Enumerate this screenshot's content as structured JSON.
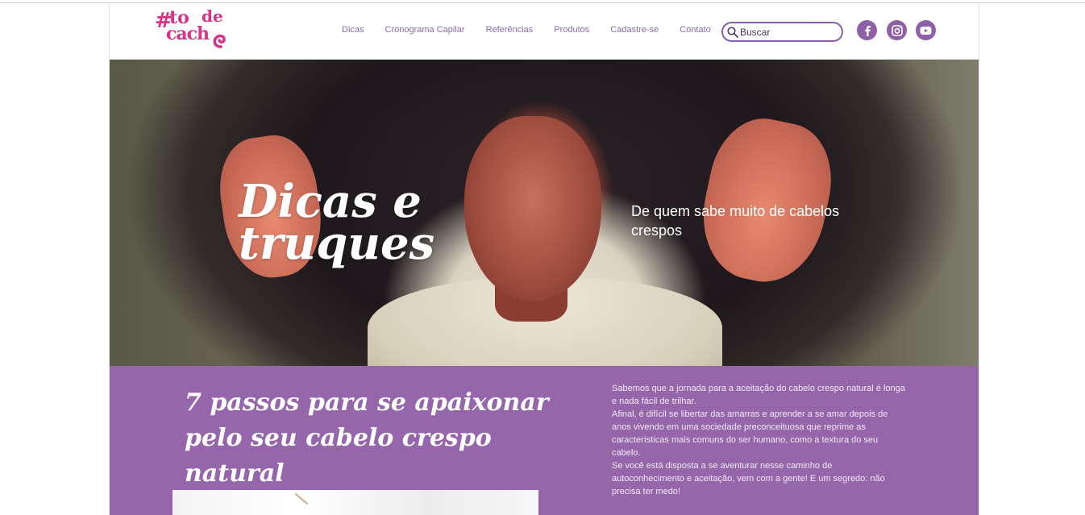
{
  "header": {
    "logo": {
      "hash": "#",
      "line1": "to",
      "line1b": "de",
      "line2": "cach"
    },
    "nav": [
      {
        "label": "Dicas"
      },
      {
        "label": "Cronograma Capilar"
      },
      {
        "label": "Referências"
      },
      {
        "label": "Produtos"
      },
      {
        "label": "Cadastre-se"
      },
      {
        "label": "Contato"
      }
    ],
    "search": {
      "placeholder": "Buscar",
      "icon": "search-icon"
    },
    "social": [
      {
        "name": "facebook-icon",
        "glyph": "f"
      },
      {
        "name": "instagram-icon"
      },
      {
        "name": "youtube-icon"
      }
    ]
  },
  "hero": {
    "title": "Dicas e truques",
    "subtitle": "De quem sabe muito de cabelos crespos"
  },
  "section": {
    "title": "7 passos para se apaixonar pelo seu cabelo crespo natural",
    "paragraphs": [
      "Sabemos que a jornada para a aceitação do cabelo crespo natural é longa e nada fácil de trilhar.",
      "Afinal, é difícil se libertar das amarras e aprender a se amar depois de anos vivendo em uma sociedade preconceituosa que reprime as características mais comuns do ser humano, como a textura do seu cabelo.",
      "Se você está disposta a se aventurar nesse caminho de autoconhecimento e aceitação, vem com a gente! E um segredo: não precisa ter medo!"
    ]
  },
  "colors": {
    "brand_pink": "#d6338a",
    "brand_purple": "#9566a9",
    "nav_text": "#8c6aa8"
  }
}
